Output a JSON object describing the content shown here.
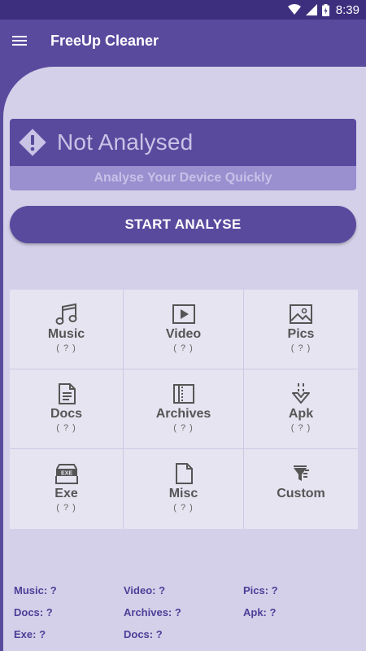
{
  "status_bar": {
    "time": "8:39"
  },
  "app_bar": {
    "title": "FreeUp Cleaner"
  },
  "status_card": {
    "title": "Not Analysed",
    "subtitle": "Analyse Your Device Quickly"
  },
  "start_button": {
    "label": "START ANALYSE"
  },
  "categories": [
    {
      "label": "Music",
      "count": "( ? )",
      "icon": "music-note-icon"
    },
    {
      "label": "Video",
      "count": "( ? )",
      "icon": "play-video-icon"
    },
    {
      "label": "Pics",
      "count": "( ? )",
      "icon": "image-icon"
    },
    {
      "label": "Docs",
      "count": "( ? )",
      "icon": "document-icon"
    },
    {
      "label": "Archives",
      "count": "( ? )",
      "icon": "archive-icon"
    },
    {
      "label": "Apk",
      "count": "( ? )",
      "icon": "apk-download-icon"
    },
    {
      "label": "Exe",
      "count": "( ? )",
      "icon": "exe-file-icon"
    },
    {
      "label": "Misc",
      "count": "( ? )",
      "icon": "blank-file-icon"
    },
    {
      "label": "Custom",
      "count": "",
      "icon": "filter-icon"
    }
  ],
  "summary": {
    "music": "Music: ?",
    "video": "Video: ?",
    "pics": "Pics: ?",
    "docs": "Docs: ?",
    "archives": "Archives: ?",
    "apk": "Apk: ?",
    "exe": "Exe: ?",
    "misc_docs": "Docs: ?"
  },
  "colors": {
    "primary": "#5a4a9e",
    "status_bar": "#3e2f7e",
    "background": "#d4d0e9",
    "tile": "#e6e4f1"
  }
}
